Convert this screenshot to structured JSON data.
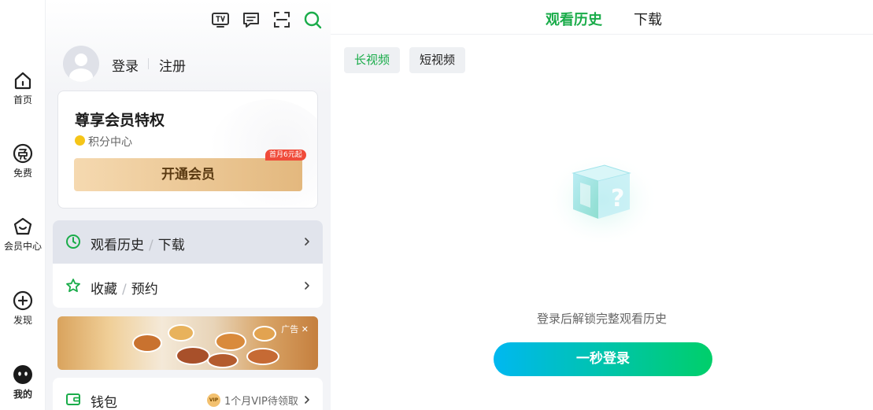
{
  "nav": {
    "items": [
      {
        "label": "首页",
        "icon": "home-icon"
      },
      {
        "label": "免费",
        "icon": "free-icon"
      },
      {
        "label": "会员中心",
        "icon": "vip-crown-icon"
      },
      {
        "label": "发现",
        "icon": "discover-plus-icon"
      },
      {
        "label": "我的",
        "icon": "profile-face-icon"
      }
    ]
  },
  "toolbar": {
    "icons": [
      "tv-icon",
      "message-icon",
      "scan-icon",
      "search-icon"
    ]
  },
  "user": {
    "login_label": "登录",
    "register_label": "注册"
  },
  "vip_card": {
    "title": "尊享会员特权",
    "points_label": "积分中心",
    "button_label": "开通会员",
    "promo_badge": "首月6元起"
  },
  "menu": {
    "history": {
      "label_a": "观看历史",
      "sep": "/",
      "label_b": "下载"
    },
    "favorites": {
      "label_a": "收藏",
      "sep": "/",
      "label_b": "预约"
    }
  },
  "ad": {
    "tag": "广告 ✕"
  },
  "wallet": {
    "label": "钱包",
    "vip_chip": "VIP",
    "sub": "1个月VIP待领取"
  },
  "right": {
    "tabs": [
      {
        "label": "观看历史",
        "active": true
      },
      {
        "label": "下载",
        "active": false
      }
    ],
    "chips": [
      {
        "label": "长视频",
        "active": true
      },
      {
        "label": "短视频",
        "active": false
      }
    ],
    "empty_text": "登录后解锁完整观看历史",
    "login_button": "一秒登录"
  },
  "colors": {
    "accent_green": "#1aac4a",
    "vip_gold": "#e3b87e",
    "login_gradient_start": "#00b8f0",
    "login_gradient_end": "#00cf6a",
    "promo_red": "#f04b3a"
  }
}
